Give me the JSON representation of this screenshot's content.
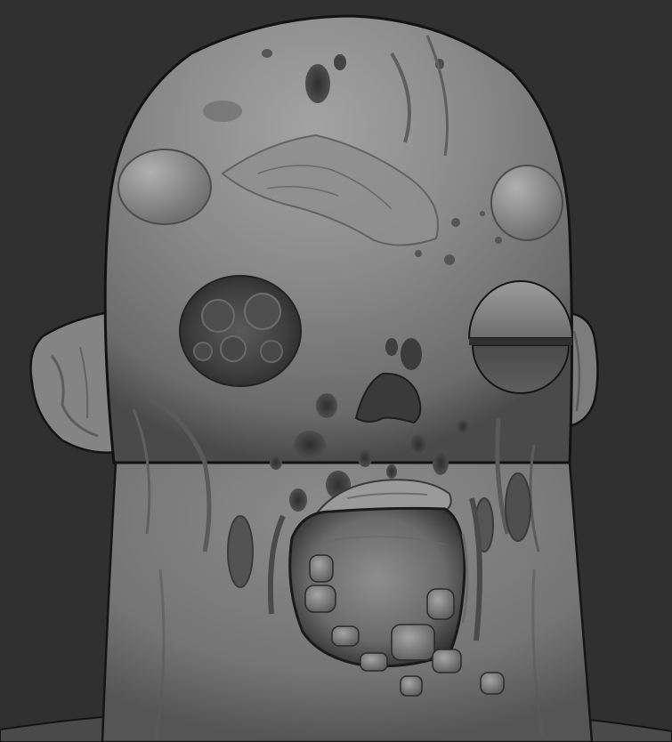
{
  "scene": {
    "background_color": "#303030",
    "subject": "sculpted-zombie-head-clay-render",
    "material_base_color": "#8a8a8a",
    "material_shadow_color": "#3a3a3a",
    "material_highlight_color": "#b5b5b5",
    "outline_color": "#111111"
  }
}
